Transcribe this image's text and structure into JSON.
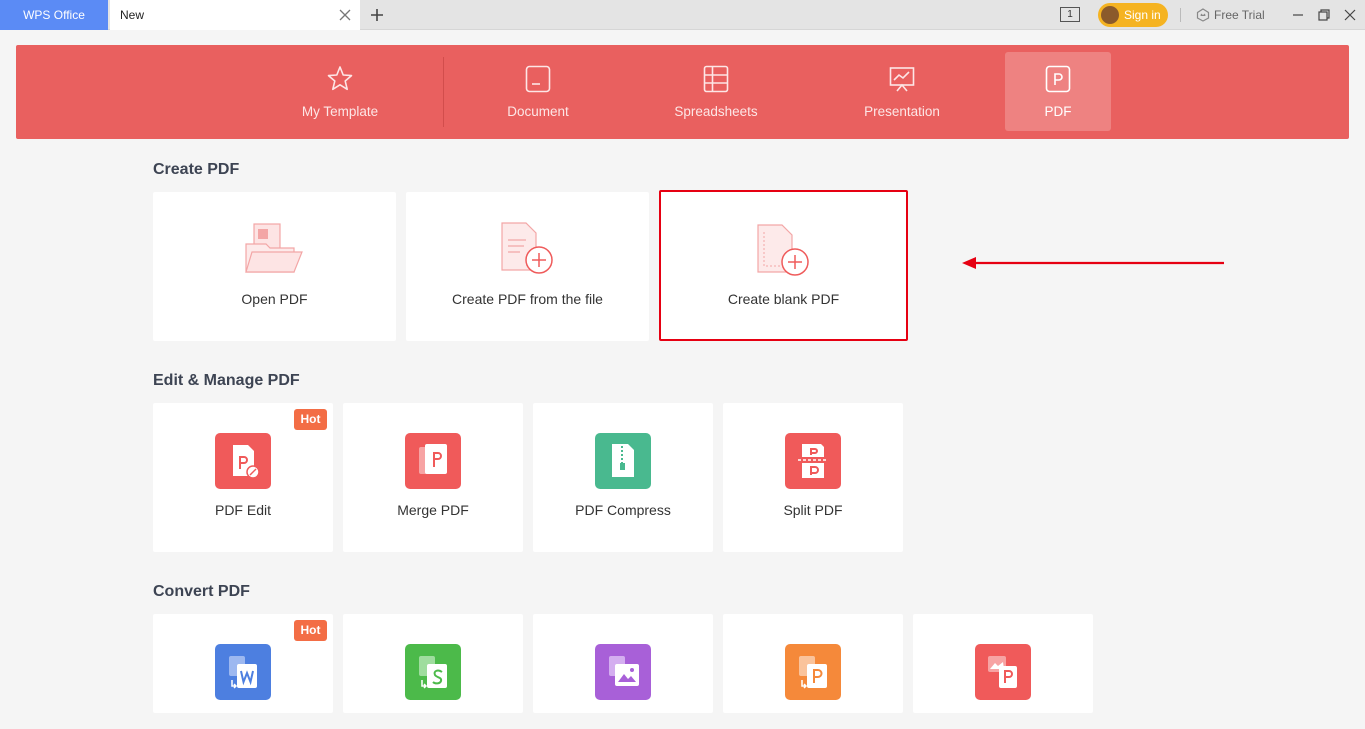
{
  "titlebar": {
    "app_tab": "WPS Office",
    "doc_tab": "New",
    "window_num": "1",
    "sign_in": "Sign in",
    "free_trial": "Free Trial"
  },
  "nav": {
    "items": [
      {
        "label": "My Template",
        "icon": "star-icon"
      },
      {
        "label": "Document",
        "icon": "document-icon"
      },
      {
        "label": "Spreadsheets",
        "icon": "spreadsheet-icon"
      },
      {
        "label": "Presentation",
        "icon": "presentation-icon"
      },
      {
        "label": "PDF",
        "icon": "pdf-icon",
        "active": true
      }
    ]
  },
  "create_pdf": {
    "title": "Create PDF",
    "cards": [
      {
        "label": "Open PDF",
        "icon": "open-pdf-icon"
      },
      {
        "label": "Create PDF from the file",
        "icon": "pdf-from-file-icon"
      },
      {
        "label": "Create blank PDF",
        "icon": "blank-pdf-icon",
        "highlighted": true
      }
    ]
  },
  "edit_manage": {
    "title": "Edit & Manage PDF",
    "cards": [
      {
        "label": "PDF Edit",
        "icon": "pdf-edit-icon",
        "badge": "Hot",
        "color": "#f05a5a"
      },
      {
        "label": "Merge PDF",
        "icon": "merge-pdf-icon",
        "color": "#f05a5a"
      },
      {
        "label": "PDF Compress",
        "icon": "pdf-compress-icon",
        "color": "#49b98f"
      },
      {
        "label": "Split PDF",
        "icon": "split-pdf-icon",
        "color": "#f05a5a"
      }
    ]
  },
  "convert": {
    "title": "Convert PDF",
    "cards": [
      {
        "icon": "pdf-to-word-icon",
        "badge": "Hot",
        "color": "#4d7fe0"
      },
      {
        "icon": "pdf-to-excel-icon",
        "color": "#4cba4a"
      },
      {
        "icon": "pdf-to-image-icon",
        "color": "#a860d8"
      },
      {
        "icon": "pdf-to-ppt-icon",
        "color": "#f5893a"
      },
      {
        "icon": "image-to-pdf-icon",
        "color": "#f05a5a"
      }
    ]
  },
  "colors": {
    "banner": "#e9605f",
    "highlight": "#e60012",
    "hot": "#f36d45"
  }
}
